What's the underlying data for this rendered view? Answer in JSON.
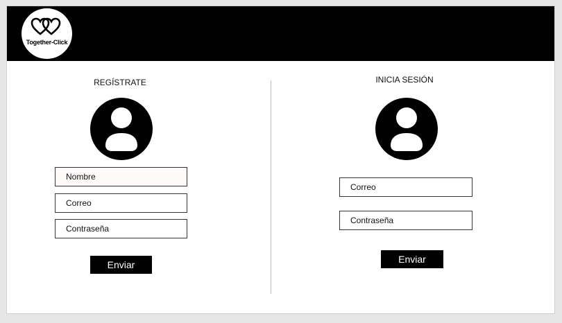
{
  "header": {
    "logo_text": "Together-Click"
  },
  "register": {
    "title": "REGÍSTRATE",
    "fields": [
      {
        "label": "Nombre"
      },
      {
        "label": "Correo"
      },
      {
        "label": "Contraseña"
      }
    ],
    "submit_label": "Enviar"
  },
  "login": {
    "title": "INICIA SESIÓN",
    "fields": [
      {
        "label": "Correo"
      },
      {
        "label": "Contraseña"
      }
    ],
    "submit_label": "Enviar"
  },
  "colors": {
    "header_bg": "#000000",
    "page_bg": "#ffffff",
    "button_bg": "#000000",
    "button_text": "#ffffff"
  },
  "icons": [
    "two-hearts-logo-icon",
    "user-avatar-icon"
  ]
}
